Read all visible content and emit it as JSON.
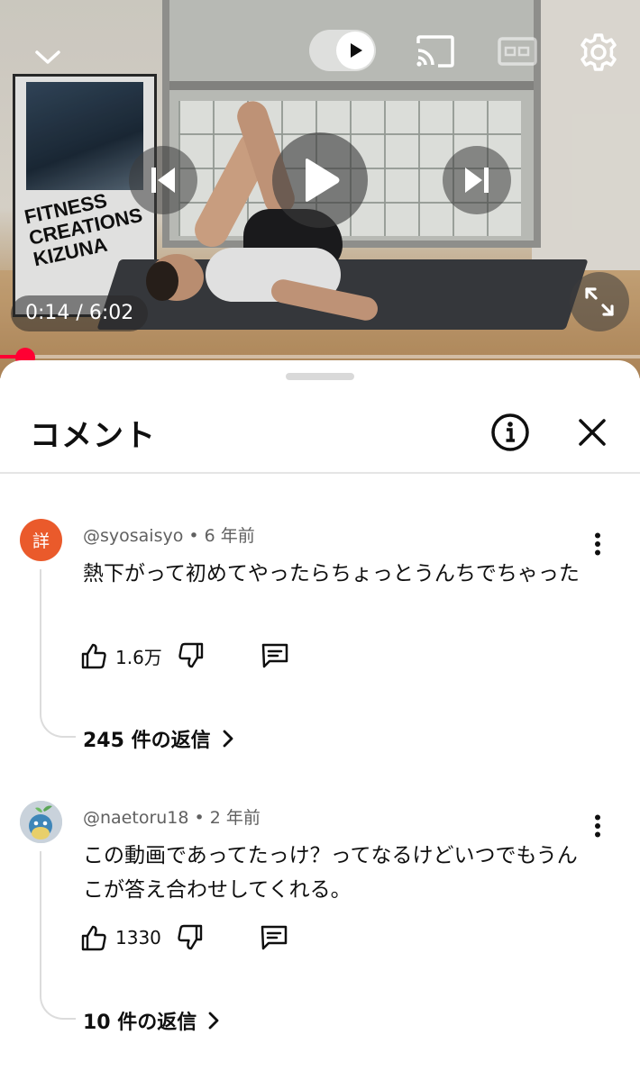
{
  "player": {
    "time_current": "0:14",
    "time_total": "6:02",
    "time_separator": "/",
    "progress_fraction": 0.039,
    "accent_color": "#ff0033",
    "poster_lines": [
      "FITNESS",
      "CREATIONS",
      "KIZUNA"
    ],
    "icons": {
      "collapse": "chevron-down-icon",
      "autoplay": "autoplay-toggle-icon",
      "cast": "cast-icon",
      "captions": "captions-icon",
      "settings": "gear-icon",
      "previous": "skip-previous-icon",
      "play": "play-icon",
      "next": "skip-next-icon",
      "fullscreen": "fullscreen-icon"
    }
  },
  "comments_sheet": {
    "title": "コメント",
    "icons": {
      "info": "info-icon",
      "close": "close-icon"
    },
    "comments": [
      {
        "avatar_text": "詳",
        "avatar_color": "#ea5a2b",
        "author": "@syosaisyo",
        "age": "6 年前",
        "text": "熱下がって初めてやったらちょっとうんちでちゃった",
        "likes": "1.6万",
        "replies": "245 件の返信"
      },
      {
        "avatar_text": "",
        "avatar_color": "#c9d2db",
        "author": "@naetoru18",
        "age": "2 年前",
        "text": "この動画であってたっけ？ってなるけどいつでもうんこが答え合わせしてくれる。",
        "likes": "1330",
        "replies": "10 件の返信"
      }
    ]
  }
}
